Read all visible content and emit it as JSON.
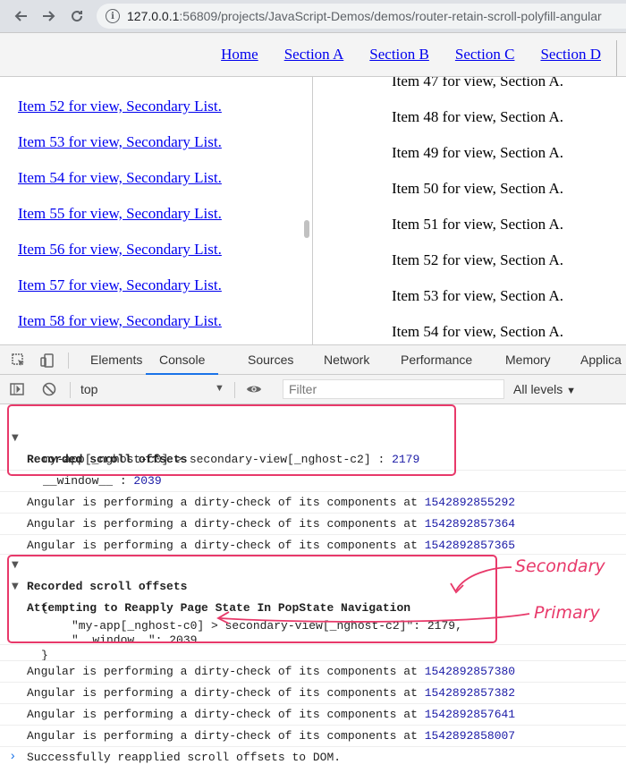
{
  "browser": {
    "url_host": "127.0.0.1",
    "url_rest": ":56809/projects/JavaScript-Demos/demos/router-retain-scroll-polyfill-angular"
  },
  "app_nav": {
    "links": [
      "Home",
      "Section A",
      "Section B",
      "Section C",
      "Section D"
    ]
  },
  "left_pane": {
    "items": [
      "Item 52 for view, Secondary List.",
      "Item 53 for view, Secondary List.",
      "Item 54 for view, Secondary List.",
      "Item 55 for view, Secondary List.",
      "Item 56 for view, Secondary List.",
      "Item 57 for view, Secondary List.",
      "Item 58 for view, Secondary List."
    ]
  },
  "right_pane": {
    "items": [
      "Item 47 for view, Section A.",
      "Item 48 for view, Section A.",
      "Item 49 for view, Section A.",
      "Item 50 for view, Section A.",
      "Item 51 for view, Section A.",
      "Item 52 for view, Section A.",
      "Item 53 for view, Section A.",
      "Item 54 for view, Section A."
    ]
  },
  "devtools": {
    "tabs": [
      "Elements",
      "Console",
      "Sources",
      "Network",
      "Performance",
      "Memory",
      "Applica"
    ],
    "active_tab": "Console",
    "context": "top",
    "filter_placeholder": "Filter",
    "levels": "All levels"
  },
  "console": {
    "group1_title": "Recorded scroll offsets",
    "group1_entry1_key": "my-app[_nghost-c0] > secondary-view[_nghost-c2]",
    "group1_entry1_sep": " : ",
    "group1_entry1_val": "2179",
    "group1_entry2_key": "__window__",
    "group1_entry2_sep": " : ",
    "group1_entry2_val": "2039",
    "dirty_check_text": "Angular is performing a dirty-check of its components at",
    "dirty_ts_1": "1542892855292",
    "dirty_ts_2": "1542892857364",
    "dirty_ts_3": "1542892857365",
    "group2_title": "Recorded scroll offsets",
    "group3_title": "Attempting to Reapply Page State In PopState Navigation",
    "json_open": "{",
    "json_line1": "\"my-app[_nghost-c0] > secondary-view[_nghost-c2]\": 2179,",
    "json_line2": "\"__window__\": 2039",
    "json_close": "}",
    "dirty_ts_4": "1542892857380",
    "dirty_ts_5": "1542892857382",
    "dirty_ts_6": "1542892857641",
    "dirty_ts_7": "1542892858007",
    "success_text": "Successfully reapplied scroll offsets to DOM."
  },
  "annotations": {
    "secondary": "Secondary",
    "primary": "Primary"
  },
  "colors": {
    "highlight": "#e8396a",
    "link": "#0000ee",
    "number": "#1a1aa6"
  }
}
